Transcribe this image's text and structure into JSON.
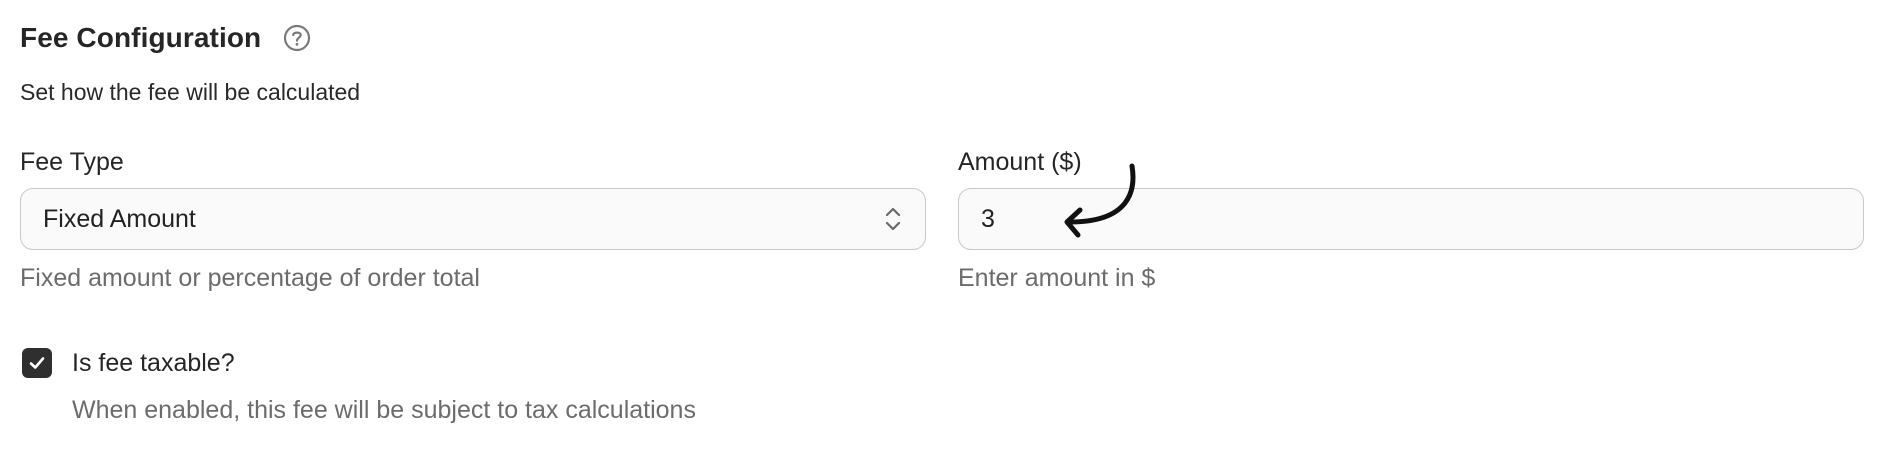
{
  "section": {
    "title": "Fee Configuration",
    "help_icon": "question-circle-icon",
    "subtitle": "Set how the fee will be calculated"
  },
  "fee_type": {
    "label": "Fee Type",
    "selected": "Fixed Amount",
    "hint": "Fixed amount or percentage of order total",
    "icon": "chevron-up-down-icon"
  },
  "amount": {
    "label": "Amount ($)",
    "value": "3",
    "hint": "Enter amount in $"
  },
  "taxable": {
    "label": "Is fee taxable?",
    "checked": true,
    "hint": "When enabled, this fee will be subject to tax calculations"
  },
  "annotation": {
    "icon": "curved-arrow-icon",
    "color": "#111111"
  },
  "colors": {
    "checkbox": "#2f2f2f",
    "border": "#c9c9c9",
    "muted_text": "#6c6c6c"
  }
}
